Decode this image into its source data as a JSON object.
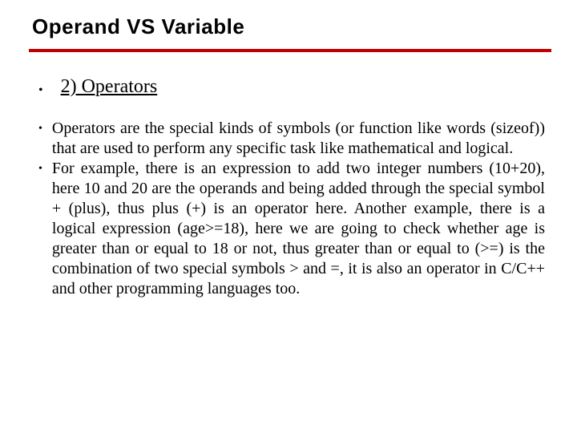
{
  "slide": {
    "title": "Operand VS Variable",
    "heading": "2) Operators",
    "bullets": [
      "Operators are the special kinds of symbols (or function like words (sizeof)) that are used to perform any specific task like mathematical and logical.",
      "For example, there is an expression to add two integer numbers (10+20), here 10 and 20 are the operands and being added through the special symbol + (plus), thus plus (+) is an operator here. Another example, there is a logical expression (age>=18), here we are going to check whether age is greater than or equal to 18 or not, thus greater than or equal to (>=) is the combination of two special symbols > and =, it is also an operator in C/C++ and other programming languages too."
    ]
  }
}
